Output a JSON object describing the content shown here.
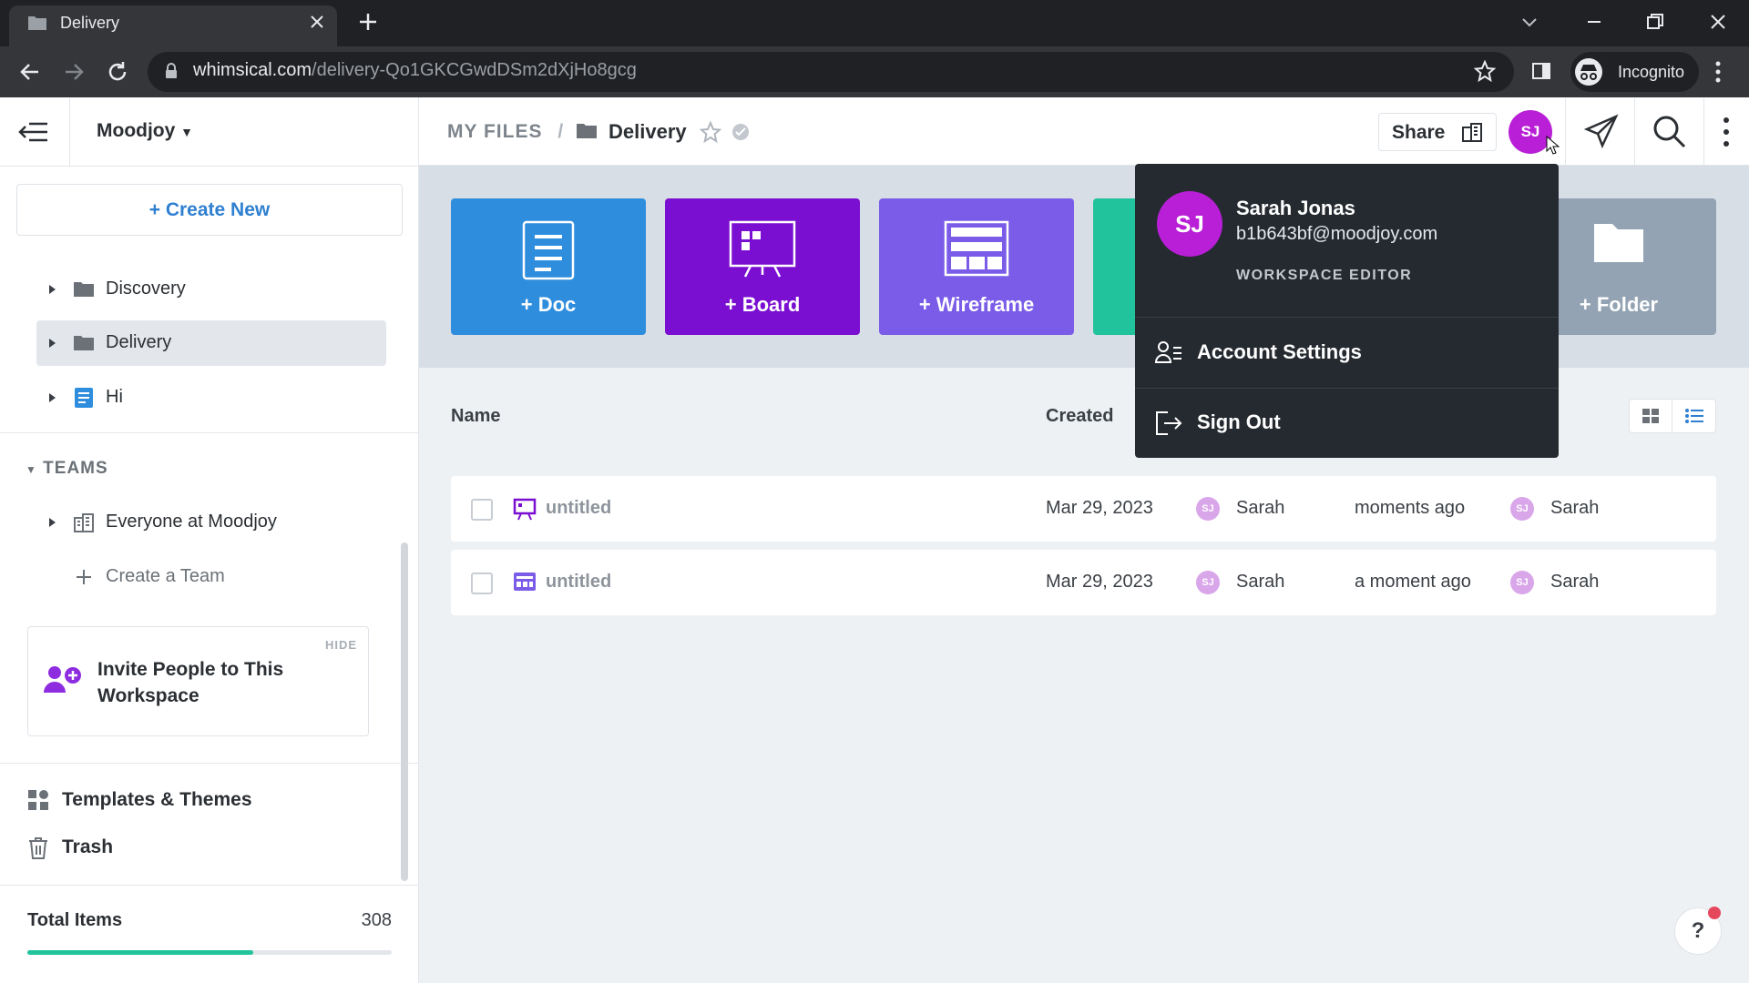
{
  "browser": {
    "tab_title": "Delivery",
    "url_host": "whimsical.com",
    "url_path": "/delivery-Qo1GKCGwdDSm2dXjHo8gcg",
    "incognito_label": "Incognito"
  },
  "sidebar": {
    "workspace": "Moodjoy",
    "create_new": "+ Create New",
    "folders": [
      {
        "label": "Discovery"
      },
      {
        "label": "Delivery"
      },
      {
        "label": "Hi"
      }
    ],
    "teams_header": "TEAMS",
    "team": "Everyone at Moodjoy",
    "create_team": "Create a Team",
    "invite": {
      "hide": "HIDE",
      "text": "Invite People to This Workspace"
    },
    "templates": "Templates & Themes",
    "trash": "Trash",
    "total_label": "Total Items",
    "total_value": "308",
    "usage_progress": 0.62
  },
  "topbar": {
    "breadcrumb_root": "MY FILES",
    "breadcrumb_sep": "/",
    "folder_name": "Delivery",
    "share_label": "Share",
    "avatar_initials": "SJ"
  },
  "tiles": {
    "doc": "+ Doc",
    "board": "+ Board",
    "wireframe": "+ Wireframe",
    "folder": "+ Folder"
  },
  "files": {
    "headers": {
      "name": "Name",
      "created": "Created"
    },
    "rows": [
      {
        "name": "untitled",
        "created": "Mar 29, 2023",
        "created_by": "Sarah",
        "edited": "moments ago",
        "edited_by": "Sarah",
        "initials": "SJ"
      },
      {
        "name": "untitled",
        "created": "Mar 29, 2023",
        "created_by": "Sarah",
        "edited": "a moment ago",
        "edited_by": "Sarah",
        "initials": "SJ"
      }
    ]
  },
  "account_menu": {
    "initials": "SJ",
    "name": "Sarah Jonas",
    "email": "b1b643bf@moodjoy.com",
    "role": "WORKSPACE EDITOR",
    "settings": "Account Settings",
    "sign_out": "Sign Out"
  },
  "help_label": "?",
  "colors": {
    "accent": "#2f80d1",
    "doc": "#2e8ddd",
    "board": "#7b0fd1",
    "wireframe": "#7a5ce8",
    "teal": "#20c39c",
    "folder": "#93a3b3",
    "avatar": "#b81fd6",
    "menu_bg": "#252a31"
  }
}
